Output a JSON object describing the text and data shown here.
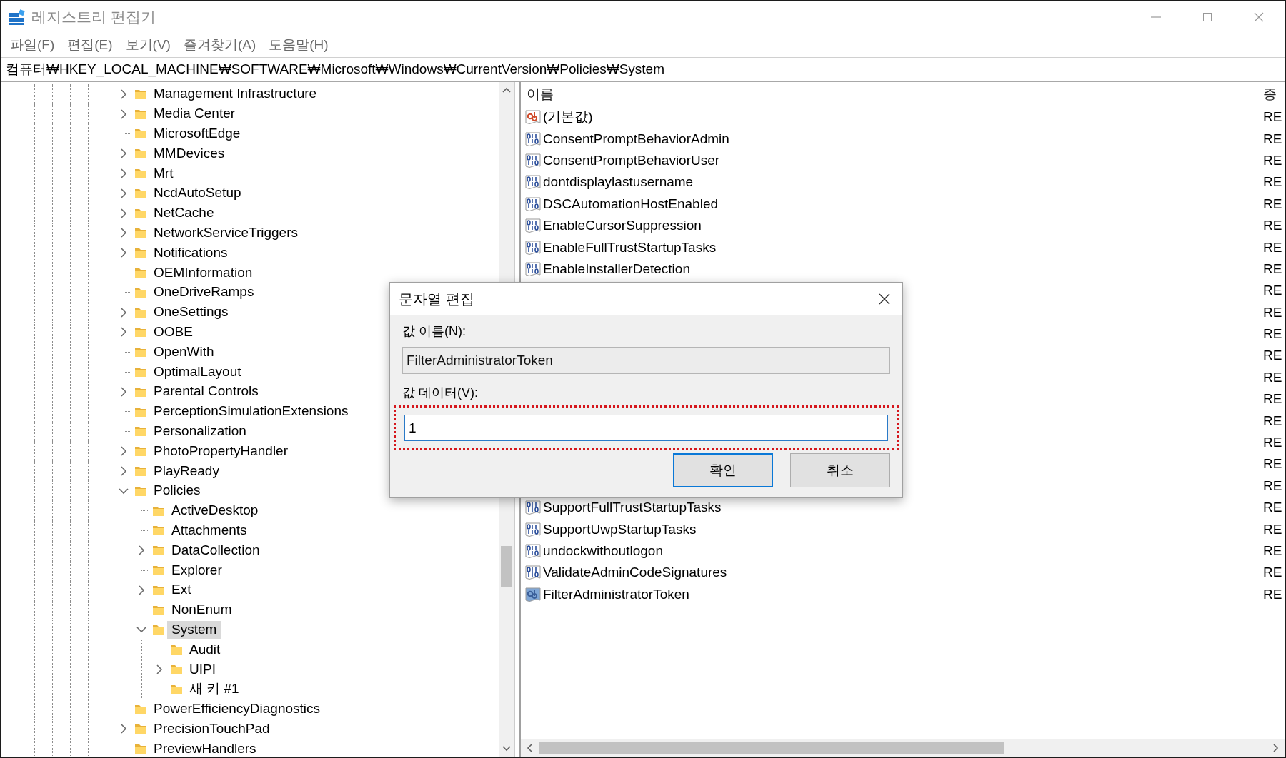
{
  "window": {
    "title": "레지스트리 편집기"
  },
  "menu": [
    "파일(F)",
    "편집(E)",
    "보기(V)",
    "즐겨찾기(A)",
    "도움말(H)"
  ],
  "address": "컴퓨터₩HKEY_LOCAL_MACHINE₩SOFTWARE₩Microsoft₩Windows₩CurrentVersion₩Policies₩System",
  "tree": {
    "items": [
      {
        "label": "Management Infrastructure",
        "expandable": true,
        "expanded": false,
        "selected": false
      },
      {
        "label": "Media Center",
        "expandable": true,
        "expanded": false,
        "selected": false
      },
      {
        "label": "MicrosoftEdge",
        "expandable": false,
        "selected": false
      },
      {
        "label": "MMDevices",
        "expandable": true,
        "expanded": false,
        "selected": false
      },
      {
        "label": "Mrt",
        "expandable": true,
        "expanded": false,
        "selected": false
      },
      {
        "label": "NcdAutoSetup",
        "expandable": true,
        "expanded": false,
        "selected": false
      },
      {
        "label": "NetCache",
        "expandable": true,
        "expanded": false,
        "selected": false
      },
      {
        "label": "NetworkServiceTriggers",
        "expandable": true,
        "expanded": false,
        "selected": false
      },
      {
        "label": "Notifications",
        "expandable": true,
        "expanded": false,
        "selected": false
      },
      {
        "label": "OEMInformation",
        "expandable": false,
        "selected": false
      },
      {
        "label": "OneDriveRamps",
        "expandable": false,
        "selected": false
      },
      {
        "label": "OneSettings",
        "expandable": true,
        "expanded": false,
        "selected": false
      },
      {
        "label": "OOBE",
        "expandable": true,
        "expanded": false,
        "selected": false
      },
      {
        "label": "OpenWith",
        "expandable": false,
        "selected": false
      },
      {
        "label": "OptimalLayout",
        "expandable": false,
        "selected": false
      },
      {
        "label": "Parental Controls",
        "expandable": true,
        "expanded": false,
        "selected": false
      },
      {
        "label": "PerceptionSimulationExtensions",
        "expandable": false,
        "selected": false
      },
      {
        "label": "Personalization",
        "expandable": false,
        "selected": false
      },
      {
        "label": "PhotoPropertyHandler",
        "expandable": true,
        "expanded": false,
        "selected": false
      },
      {
        "label": "PlayReady",
        "expandable": true,
        "expanded": false,
        "selected": false
      },
      {
        "label": "Policies",
        "expandable": true,
        "expanded": true,
        "selected": false,
        "children": [
          {
            "label": "ActiveDesktop",
            "expandable": false,
            "selected": false
          },
          {
            "label": "Attachments",
            "expandable": false,
            "selected": false
          },
          {
            "label": "DataCollection",
            "expandable": true,
            "expanded": false,
            "selected": false
          },
          {
            "label": "Explorer",
            "expandable": false,
            "selected": false
          },
          {
            "label": "Ext",
            "expandable": true,
            "expanded": false,
            "selected": false
          },
          {
            "label": "NonEnum",
            "expandable": false,
            "selected": false
          },
          {
            "label": "System",
            "expandable": true,
            "expanded": true,
            "selected": true,
            "children": [
              {
                "label": "Audit",
                "expandable": false,
                "selected": false
              },
              {
                "label": "UIPI",
                "expandable": true,
                "expanded": false,
                "selected": false
              },
              {
                "label": "새 키 #1",
                "expandable": false,
                "selected": false
              }
            ]
          }
        ]
      },
      {
        "label": "PowerEfficiencyDiagnostics",
        "expandable": false,
        "selected": false
      },
      {
        "label": "PrecisionTouchPad",
        "expandable": true,
        "expanded": false,
        "selected": false
      },
      {
        "label": "PreviewHandlers",
        "expandable": false,
        "selected": false
      }
    ]
  },
  "values": {
    "columns": [
      "이름",
      "종"
    ],
    "rows": [
      {
        "kind": "string",
        "name": "(기본값)",
        "type": "RE",
        "selected": false
      },
      {
        "kind": "dword",
        "name": "ConsentPromptBehaviorAdmin",
        "type": "RE",
        "selected": false
      },
      {
        "kind": "dword",
        "name": "ConsentPromptBehaviorUser",
        "type": "RE",
        "selected": false
      },
      {
        "kind": "dword",
        "name": "dontdisplaylastusername",
        "type": "RE",
        "selected": false
      },
      {
        "kind": "dword",
        "name": "DSCAutomationHostEnabled",
        "type": "RE",
        "selected": false
      },
      {
        "kind": "dword",
        "name": "EnableCursorSuppression",
        "type": "RE",
        "selected": false
      },
      {
        "kind": "dword",
        "name": "EnableFullTrustStartupTasks",
        "type": "RE",
        "selected": false
      },
      {
        "kind": "dword",
        "name": "EnableInstallerDetection",
        "type": "RE",
        "selected": false
      },
      {
        "type": "RE"
      },
      {
        "type": "RE"
      },
      {
        "type": "RE"
      },
      {
        "type": "RE"
      },
      {
        "type": "RE"
      },
      {
        "type": "RE"
      },
      {
        "type": "RE"
      },
      {
        "type": "RE"
      },
      {
        "type": "RE"
      },
      {
        "type": "RE"
      },
      {
        "kind": "dword",
        "name": "SupportFullTrustStartupTasks",
        "type": "RE",
        "selected": false
      },
      {
        "kind": "dword",
        "name": "SupportUwpStartupTasks",
        "type": "RE",
        "selected": false
      },
      {
        "kind": "dword",
        "name": "undockwithoutlogon",
        "type": "RE",
        "selected": false
      },
      {
        "kind": "dword",
        "name": "ValidateAdminCodeSignatures",
        "type": "RE",
        "selected": false
      },
      {
        "kind": "string",
        "name": "FilterAdministratorToken",
        "type": "RE",
        "selected": true
      }
    ]
  },
  "dialog": {
    "title": "문자열 편집",
    "name_label": "값 이름(N):",
    "name_value": "FilterAdministratorToken",
    "data_label": "값 데이터(V):",
    "data_value": "1",
    "data_highlighted": true,
    "buttons": [
      {
        "label": "확인",
        "default": true
      },
      {
        "label": "취소",
        "default": false
      }
    ]
  }
}
